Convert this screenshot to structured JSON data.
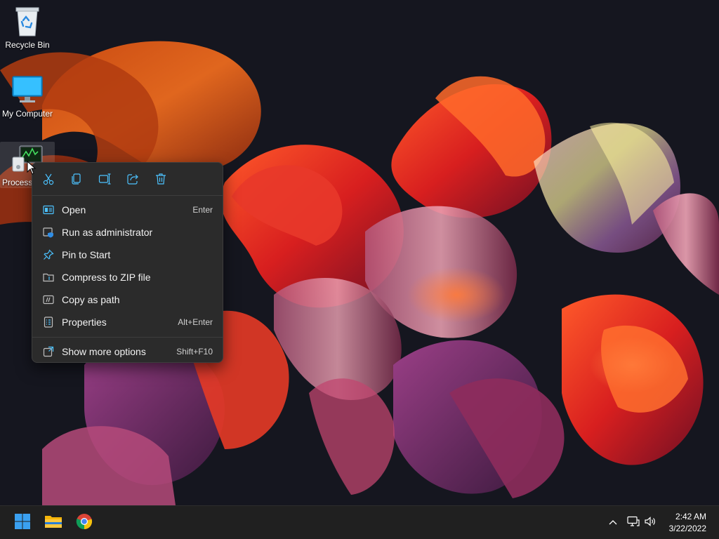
{
  "desktop": {
    "icons": [
      {
        "label": "Recycle Bin",
        "icon": "recycle-bin-icon"
      },
      {
        "label": "My Computer",
        "icon": "monitor-icon"
      },
      {
        "label": "Process",
        "icon": "process-app-icon"
      }
    ]
  },
  "context_menu": {
    "quick_actions": [
      {
        "name": "cut",
        "icon": "scissors-icon"
      },
      {
        "name": "copy",
        "icon": "copy-icon"
      },
      {
        "name": "rename",
        "icon": "rename-icon"
      },
      {
        "name": "share",
        "icon": "share-icon"
      },
      {
        "name": "delete",
        "icon": "trash-icon"
      }
    ],
    "items": [
      {
        "label": "Open",
        "accelerator": "Enter",
        "icon": "open-icon"
      },
      {
        "label": "Run as administrator",
        "accelerator": "",
        "icon": "shield-window-icon"
      },
      {
        "label": "Pin to Start",
        "accelerator": "",
        "icon": "pin-icon"
      },
      {
        "label": "Compress to ZIP file",
        "accelerator": "",
        "icon": "zip-folder-icon"
      },
      {
        "label": "Copy as path",
        "accelerator": "",
        "icon": "path-icon"
      },
      {
        "label": "Properties",
        "accelerator": "Alt+Enter",
        "icon": "properties-icon"
      }
    ],
    "more": {
      "label": "Show more options",
      "accelerator": "Shift+F10",
      "icon": "more-options-icon"
    }
  },
  "taskbar": {
    "apps": [
      {
        "name": "start",
        "icon": "windows-start-icon"
      },
      {
        "name": "file-explorer",
        "icon": "folder-icon"
      },
      {
        "name": "chrome",
        "icon": "chrome-icon"
      }
    ],
    "tray": [
      "chevron-up-icon",
      "network-icon",
      "volume-icon"
    ],
    "time": "2:42 AM",
    "date": "3/22/2022"
  },
  "colors": {
    "menu_bg": "#2b2b2b",
    "taskbar_bg": "#202020",
    "wallpaper_base": "#15161f",
    "accent": "#4cc2ff"
  }
}
